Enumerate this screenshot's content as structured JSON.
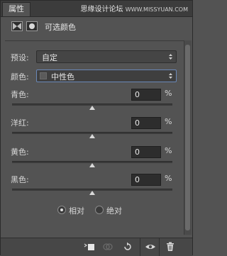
{
  "tab": {
    "label": "属性"
  },
  "watermark": {
    "line1": "思缘设计论坛",
    "line2": "WWW.MISSYUAN.COM"
  },
  "header": {
    "title": "可选颜色"
  },
  "preset": {
    "label": "预设:",
    "value": "自定"
  },
  "colors": {
    "label": "颜色:",
    "value": "中性色"
  },
  "sliders": [
    {
      "label": "青色:",
      "value": "0",
      "unit": "%",
      "level": 0.5
    },
    {
      "label": "洋红:",
      "value": "0",
      "unit": "%",
      "level": 0.5
    },
    {
      "label": "黄色:",
      "value": "0",
      "unit": "%",
      "level": 0.5
    },
    {
      "label": "黑色:",
      "value": "0",
      "unit": "%",
      "level": 0.5
    }
  ],
  "method": {
    "options": [
      {
        "label": "相对",
        "checked": true
      },
      {
        "label": "绝对",
        "checked": false
      }
    ]
  },
  "icons": {
    "mask": "layer-mask-icon",
    "circle": "pixel-mask-icon",
    "clip": "clip-to-layer-icon",
    "view_previous": "view-previous-icon",
    "reset": "reset-icon",
    "visibility": "eye-icon",
    "delete": "trash-icon"
  }
}
